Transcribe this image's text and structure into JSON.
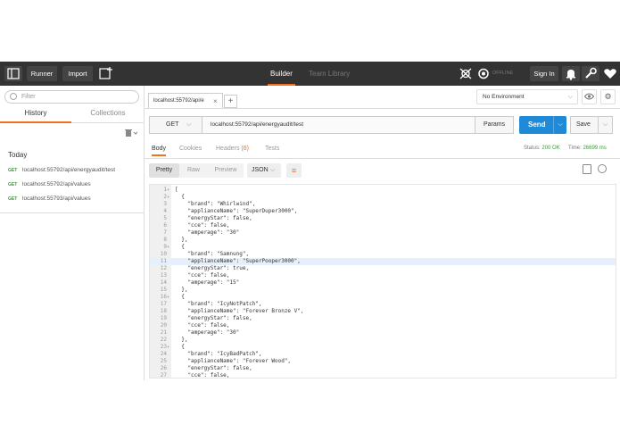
{
  "topbar": {
    "runner_label": "Runner",
    "import_label": "Import",
    "builder_tab": "Builder",
    "team_library_tab": "Team Library",
    "offline_label": "OFFLINE",
    "signin_label": "Sign In"
  },
  "sidebar": {
    "filter_placeholder": "Filter",
    "tabs": [
      "History",
      "Collections"
    ],
    "section_title": "Today",
    "history": [
      {
        "method": "GET",
        "url": "localhost:55792/api/energyaudit/test"
      },
      {
        "method": "GET",
        "url": "localhost:55792/api/values"
      },
      {
        "method": "GET",
        "url": "localhost:55793/api/values"
      }
    ]
  },
  "request": {
    "tab_label": "localhost:55792/api/e",
    "environment": "No Environment",
    "method": "GET",
    "url": "localhost:55792/api/energyaudit/test",
    "params_label": "Params",
    "send_label": "Send",
    "save_label": "Save"
  },
  "response": {
    "tabs": {
      "body": "Body",
      "cookies": "Cookies",
      "headers": "Headers",
      "headers_count": "(6)",
      "tests": "Tests"
    },
    "status_label": "Status:",
    "status_value": "200 OK",
    "time_label": "Time:",
    "time_value": "26699 ms",
    "view_modes": {
      "pretty": "Pretty",
      "raw": "Raw",
      "preview": "Preview"
    },
    "format": "JSON",
    "lines": [
      {
        "n": "1",
        "fold": "▾",
        "text": "["
      },
      {
        "n": "2",
        "fold": "▾",
        "text": "  {"
      },
      {
        "n": "3",
        "fold": "",
        "text": "    \"brand\": \"Whirlwind\","
      },
      {
        "n": "4",
        "fold": "",
        "text": "    \"applianceName\": \"SuperDuper3000\","
      },
      {
        "n": "5",
        "fold": "",
        "text": "    \"energyStar\": false,"
      },
      {
        "n": "6",
        "fold": "",
        "text": "    \"cce\": false,"
      },
      {
        "n": "7",
        "fold": "",
        "text": "    \"amperage\": \"30\""
      },
      {
        "n": "8",
        "fold": "",
        "text": "  },"
      },
      {
        "n": "9",
        "fold": "▾",
        "text": "  {"
      },
      {
        "n": "10",
        "fold": "",
        "text": "    \"brand\": \"Samnung\","
      },
      {
        "n": "11",
        "fold": "",
        "text": "    \"applianceName\": \"SuperPooper3000\","
      },
      {
        "n": "12",
        "fold": "",
        "text": "    \"energyStar\": true,"
      },
      {
        "n": "13",
        "fold": "",
        "text": "    \"cce\": false,"
      },
      {
        "n": "14",
        "fold": "",
        "text": "    \"amperage\": \"15\""
      },
      {
        "n": "15",
        "fold": "",
        "text": "  },"
      },
      {
        "n": "16",
        "fold": "▾",
        "text": "  {"
      },
      {
        "n": "17",
        "fold": "",
        "text": "    \"brand\": \"IcyNotPatch\","
      },
      {
        "n": "18",
        "fold": "",
        "text": "    \"applianceName\": \"Forever Bronze V\","
      },
      {
        "n": "19",
        "fold": "",
        "text": "    \"energyStar\": false,"
      },
      {
        "n": "20",
        "fold": "",
        "text": "    \"cce\": false,"
      },
      {
        "n": "21",
        "fold": "",
        "text": "    \"amperage\": \"30\""
      },
      {
        "n": "22",
        "fold": "",
        "text": "  },"
      },
      {
        "n": "23",
        "fold": "▾",
        "text": "  {"
      },
      {
        "n": "24",
        "fold": "",
        "text": "    \"brand\": \"IcyBadPatch\","
      },
      {
        "n": "25",
        "fold": "",
        "text": "    \"applianceName\": \"Forever Wood\","
      },
      {
        "n": "26",
        "fold": "",
        "text": "    \"energyStar\": false,"
      },
      {
        "n": "27",
        "fold": "",
        "text": "    \"cce\": false,"
      }
    ],
    "highlighted_line": "11"
  },
  "colors": {
    "accent": "#f47023",
    "send": "#1f8ad7",
    "topbar": "#333333",
    "success": "#3c9a3c"
  }
}
